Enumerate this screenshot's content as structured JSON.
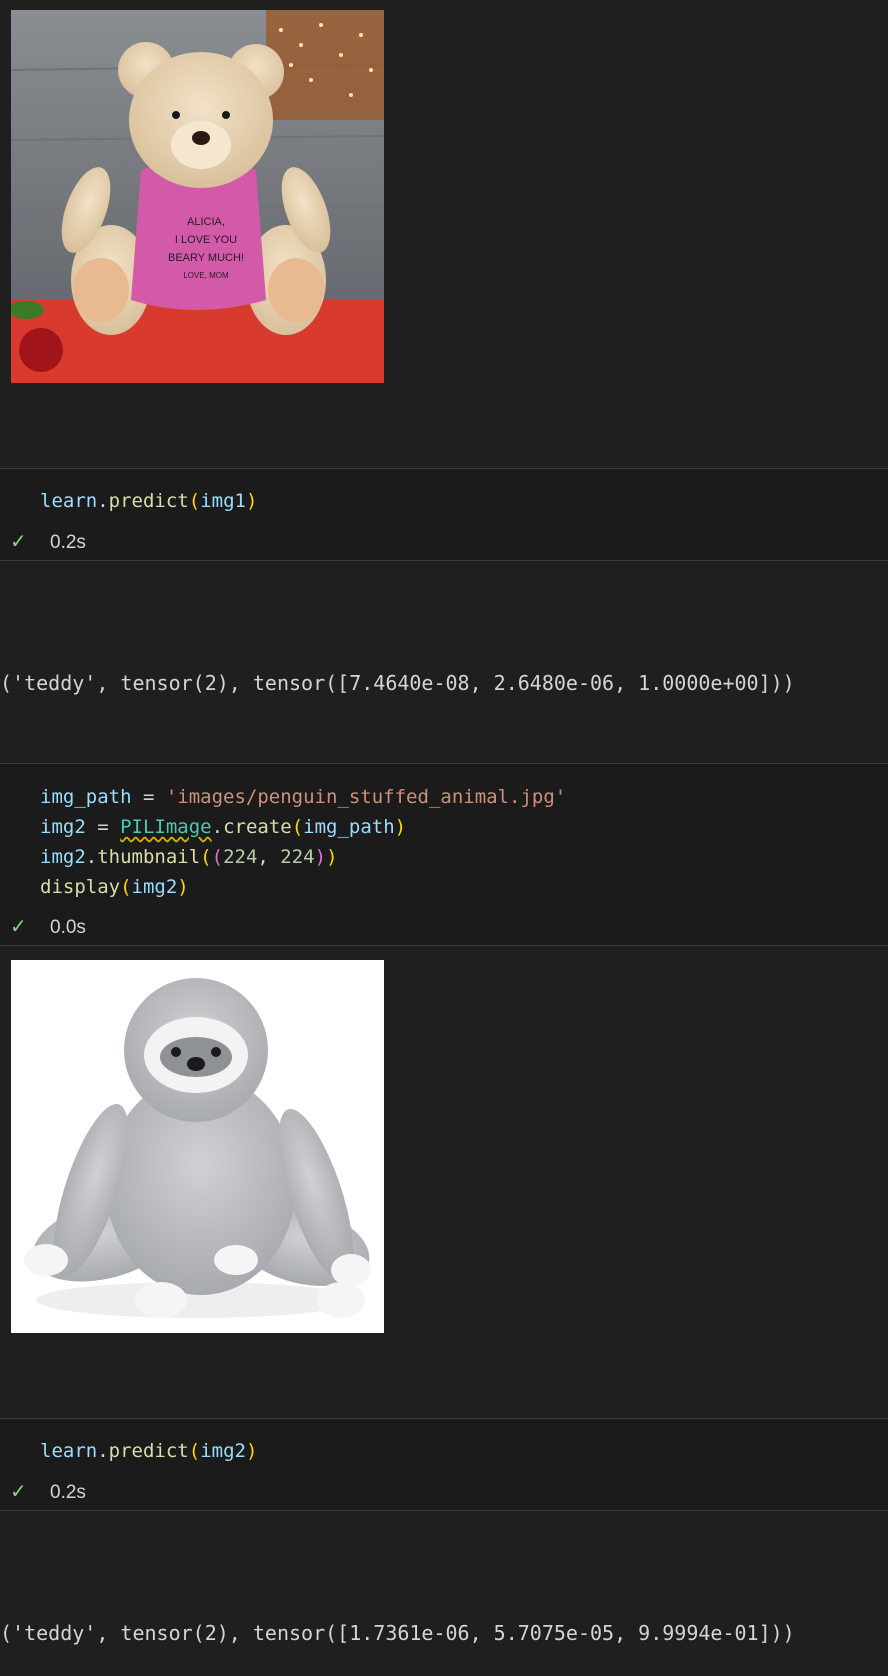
{
  "cell1": {
    "image_desc": "teddy bear",
    "shirt_lines": [
      "ALICIA,",
      "I LOVE YOU",
      "BEARY MUCH!",
      "LOVE, MOM"
    ]
  },
  "cell2": {
    "code": {
      "var": "learn",
      "fn": "predict",
      "arg": "img1"
    },
    "status": "0.2s",
    "output": "('teddy', tensor(2), tensor([7.4640e-08, 2.6480e-06, 1.0000e+00]))"
  },
  "cell3": {
    "line1": {
      "var": "img_path",
      "op": " = ",
      "str": "'images/penguin_stuffed_animal.jpg'"
    },
    "line2": {
      "var": "img2",
      "op": " = ",
      "cls": "PILImage",
      "fn": "create",
      "arg": "img_path"
    },
    "line3": {
      "var": "img2",
      "fn": "thumbnail",
      "n1": "224",
      "n2": "224"
    },
    "line4": {
      "fn": "display",
      "arg": "img2"
    },
    "status": "0.0s"
  },
  "cell4": {
    "code": {
      "var": "learn",
      "fn": "predict",
      "arg": "img2"
    },
    "status": "0.2s",
    "output": "('teddy', tensor(2), tensor([1.7361e-06, 5.7075e-05, 9.9994e-01]))"
  },
  "icons": {
    "check": "checkmark-icon"
  },
  "colors": {
    "success": "#89d185",
    "background": "#1f1f1f",
    "code_bg": "#1b1b1c"
  }
}
